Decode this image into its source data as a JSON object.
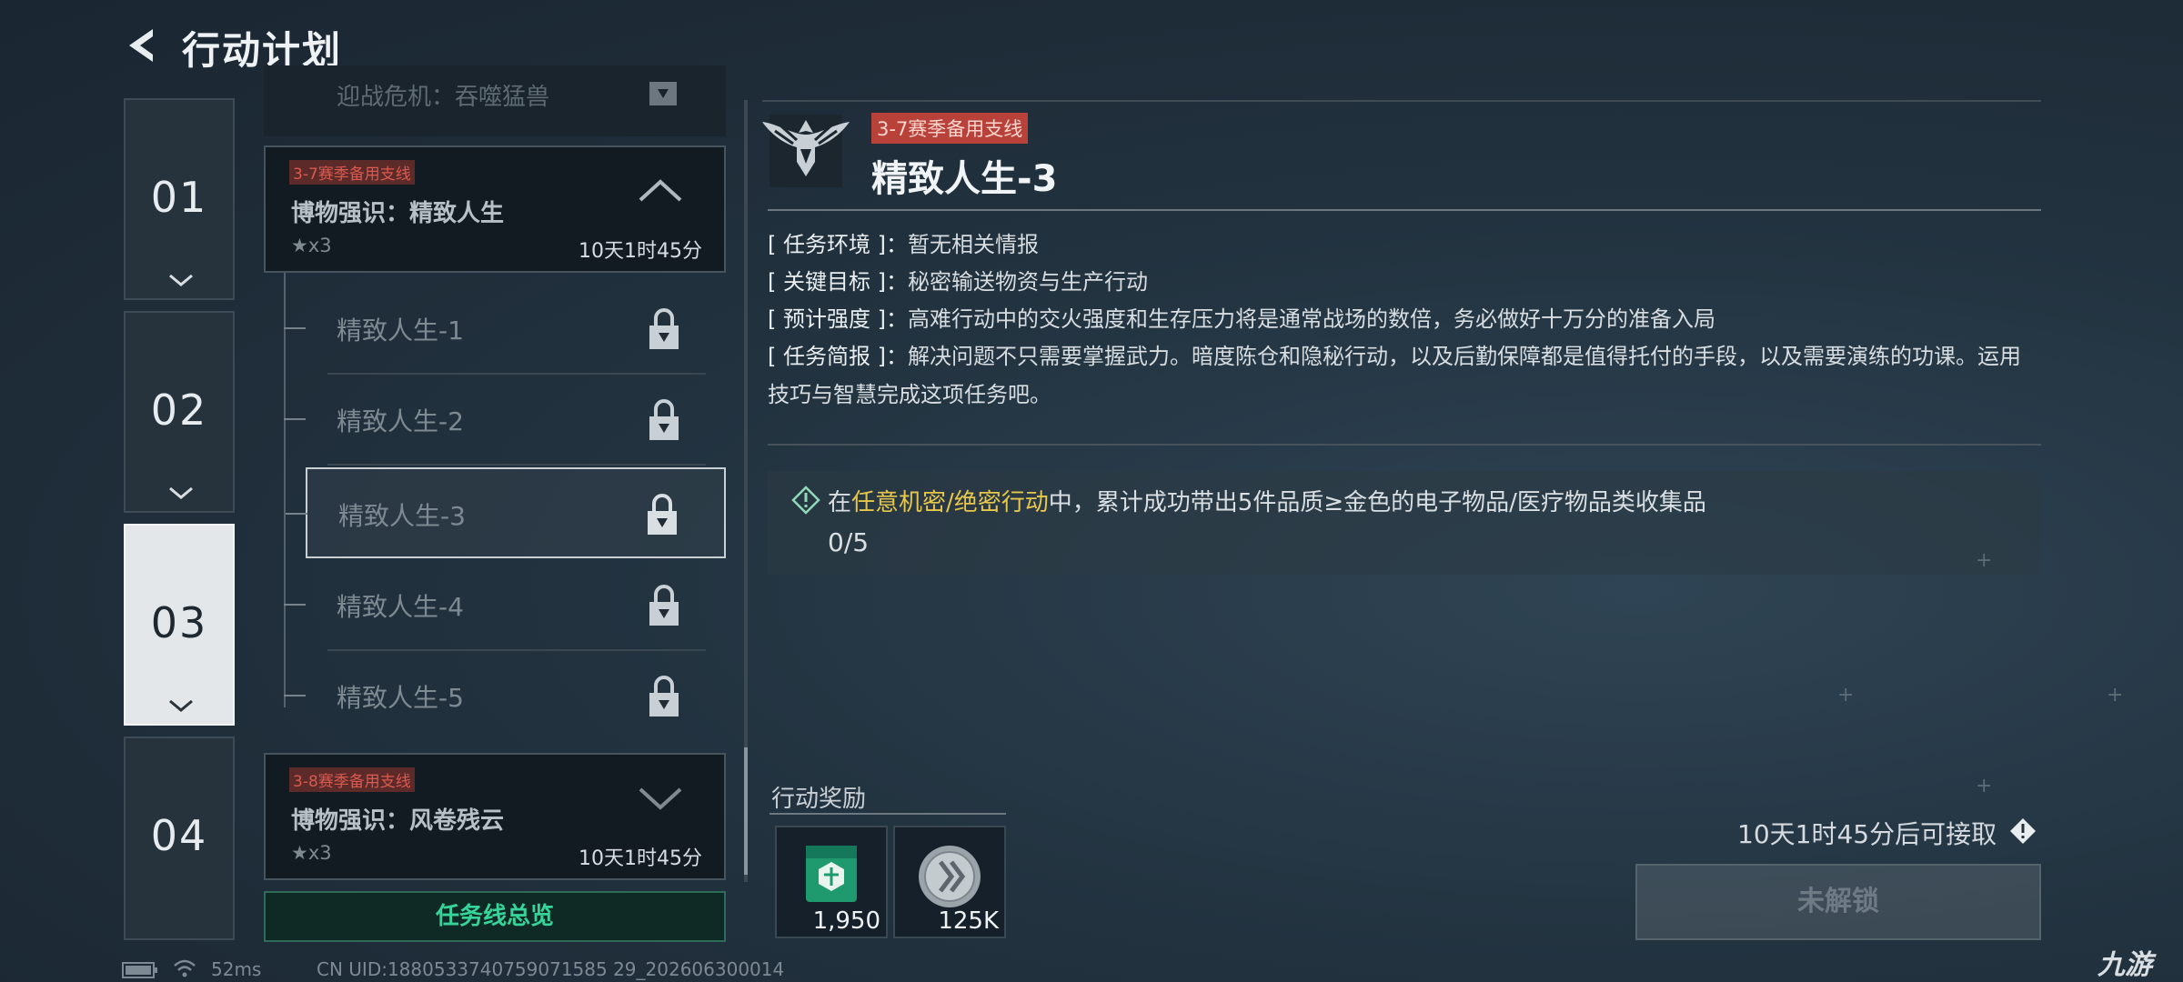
{
  "header": {
    "title": "行动计划"
  },
  "chapter_tabs": [
    {
      "label": "01"
    },
    {
      "label": "02"
    },
    {
      "label": "03"
    },
    {
      "label": "04"
    }
  ],
  "mission_list": {
    "partial_above": "迎战危机：吞噬猛兽",
    "cards": [
      {
        "tag": "3-7赛季备用支线",
        "title": "博物强识：精致人生",
        "stars": "★x3",
        "time": "10天1时45分"
      },
      {
        "tag": "3-8赛季备用支线",
        "title": "博物强识：风卷残云",
        "stars": "★x3",
        "time": "10天1时45分"
      }
    ],
    "sub_missions": [
      {
        "name": "精致人生-1"
      },
      {
        "name": "精致人生-2"
      },
      {
        "name": "精致人生-3"
      },
      {
        "name": "精致人生-4"
      },
      {
        "name": "精致人生-5"
      }
    ],
    "overview_button": "任务线总览"
  },
  "status_bar": {
    "ping": "52ms",
    "uid": "CN UID:1880533740759071585 29_202606300014"
  },
  "detail": {
    "season_tag": "3-7赛季备用支线",
    "title": "精致人生-3",
    "info": [
      {
        "label": "[ 任务环境 ]：",
        "value": "暂无相关情报"
      },
      {
        "label": "[ 关键目标 ]：",
        "value": "秘密输送物资与生产行动"
      },
      {
        "label": "[ 预计强度 ]：",
        "value": "高难行动中的交火强度和生存压力将是通常战场的数倍，务必做好十万分的准备入局"
      },
      {
        "label": "[ 任务简报 ]：",
        "value": "解决问题不只需要掌握武力。暗度陈仓和隐秘行动，以及后勤保障都是值得托付的手段，以及需要演练的功课。运用技巧与智慧完成这项任务吧。"
      }
    ],
    "objective": {
      "prefix": "在",
      "highlight": "任意机密/绝密行动",
      "suffix": "中，累计成功带出5件品质≥金色的电子物品/医疗物品类收集品",
      "progress": "0/5"
    },
    "reward_title": "行动奖励",
    "rewards": [
      {
        "quantity": "1,950",
        "icon": "supply-crate-icon"
      },
      {
        "quantity": "125K",
        "icon": "coin-icon"
      }
    ],
    "available_text": "10天1时45分后可接取",
    "locked_button": "未解锁"
  },
  "watermark": "九游",
  "colors": {
    "accent_green": "#36d39a",
    "tag_red": "#b8413a",
    "highlight_yellow": "#e7c74b"
  }
}
